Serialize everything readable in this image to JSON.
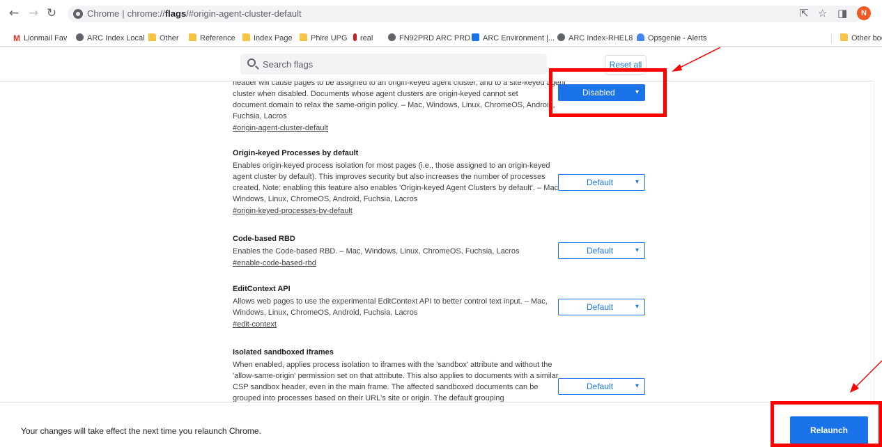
{
  "browser": {
    "omnibox": {
      "prefix": "Chrome",
      "host": "flags",
      "scheme_start": "chrome://",
      "path": "/#origin-agent-cluster-default"
    },
    "avatar_letter": "N"
  },
  "bookmarks": [
    {
      "label": "Lionmail Fav",
      "icon": "gmail-icon"
    },
    {
      "label": "ARC Index Local",
      "icon": "globe-icon"
    },
    {
      "label": "Other",
      "icon": "folder-icon"
    },
    {
      "label": "Reference",
      "icon": "folder-icon"
    },
    {
      "label": "Index Page",
      "icon": "folder-icon"
    },
    {
      "label": "Phire UPG",
      "icon": "folder-icon"
    },
    {
      "label": "real",
      "icon": "pin-icon"
    },
    {
      "label": "FN92PRD ARC PRD",
      "icon": "globe-icon"
    },
    {
      "label": "ARC Environment |...",
      "icon": "crown-icon"
    },
    {
      "label": "ARC Index-RHEL8",
      "icon": "globe-icon"
    },
    {
      "label": "Opsgenie - Alerts",
      "icon": "opsgenie-icon"
    }
  ],
  "other_bookmarks": "Other bookm",
  "search": {
    "placeholder": "Search flags"
  },
  "reset_label": "Reset all",
  "flags": [
    {
      "title": "",
      "desc": "header will cause pages to be assigned to an origin-keyed agent cluster, and to a site-keyed agent cluster when disabled. Documents whose agent clusters are origin-keyed cannot set document.domain to relax the same-origin policy. – Mac, Windows, Linux, ChromeOS, Android, Fuchsia, Lacros",
      "link": "#origin-agent-cluster-default",
      "value": "Disabled"
    },
    {
      "title": "Origin-keyed Processes by default",
      "desc": "Enables origin-keyed process isolation for most pages (i.e., those assigned to an origin-keyed agent cluster by default). This improves security but also increases the number of processes created. Note: enabling this feature also enables 'Origin-keyed Agent Clusters by default'. – Mac, Windows, Linux, ChromeOS, Android, Fuchsia, Lacros",
      "link": "#origin-keyed-processes-by-default",
      "value": "Default"
    },
    {
      "title": "Code-based RBD",
      "desc": "Enables the Code-based RBD. – Mac, Windows, Linux, ChromeOS, Fuchsia, Lacros",
      "link": "#enable-code-based-rbd",
      "value": "Default"
    },
    {
      "title": "EditContext API",
      "desc": "Allows web pages to use the experimental EditContext API to better control text input. – Mac, Windows, Linux, ChromeOS, Android, Fuchsia, Lacros",
      "link": "#edit-context",
      "value": "Default"
    },
    {
      "title": "Isolated sandboxed iframes",
      "desc": "When enabled, applies process isolation to iframes with the 'sandbox' attribute and without the 'allow-same-origin' permission set on that attribute. This also applies to documents with a similar CSP sandbox header, even in the main frame. The affected sandboxed documents can be grouped into processes based on their URL's site or origin. The default grouping",
      "link": "",
      "value": "Default"
    }
  ],
  "bottom": {
    "message": "Your changes will take effect the next time you relaunch Chrome.",
    "relaunch_label": "Relaunch"
  },
  "colors": {
    "accent": "#1a73e8",
    "annotation": "#ff0000"
  }
}
